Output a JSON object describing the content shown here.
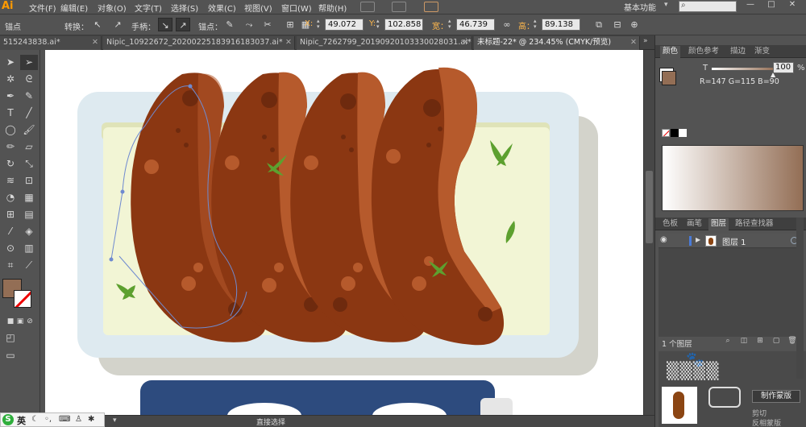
{
  "menubar": {
    "logo": "Ai",
    "items": [
      "文件(F)",
      "编辑(E)",
      "对象(O)",
      "文字(T)",
      "选择(S)",
      "效果(C)",
      "视图(V)",
      "窗口(W)",
      "帮助(H)"
    ],
    "workspace": "基本功能"
  },
  "controlbar": {
    "tool_label": "锚点",
    "convert_label": "转换：",
    "handle_label": "手柄：",
    "anchor_label": "锚点：",
    "x_label": "X:",
    "x_value": "49.072",
    "y_label": "Y:",
    "y_value": "102.858",
    "w_label": "宽：",
    "w_value": "46.739",
    "h_label": "高：",
    "h_value": "89.138"
  },
  "tabs": [
    {
      "label": "515243838.ai*",
      "active": false
    },
    {
      "label": "Nipic_10922672_20200225183916183037.ai*",
      "active": false
    },
    {
      "label": "Nipic_7262799_20190920103330028031.ai*",
      "active": false
    },
    {
      "label": "未标题-22* @ 234.45% (CMYK/预览)",
      "active": true
    }
  ],
  "color_panel": {
    "tabs": [
      "颜色",
      "颜色参考",
      "描边",
      "渐变"
    ],
    "tint_label": "T",
    "tint_value": "100",
    "tint_unit": "%",
    "readout": "R=147 G=115 B=90",
    "fill_color": "#936e55"
  },
  "layers_panel": {
    "tabs": [
      "色板",
      "画笔",
      "图层",
      "路径查找器"
    ],
    "layers": [
      {
        "name": "图层 1"
      }
    ],
    "count": "1 个图层"
  },
  "bottom_panel": {
    "mask_button": "制作蒙版",
    "clip_label": "剪切",
    "invert_label": "反相蒙版"
  },
  "statusbar": {
    "tool_status": "直接选择",
    "ime_lang": "英"
  },
  "artwork": {
    "sausage_dark": "#8b3712",
    "sausage_light": "#b65a2c",
    "tray_color": "#deeaf0",
    "tray_shadow": "#d3d3cb",
    "plate_color": "#f2f5d5",
    "leaf_color": "#5da02f",
    "dish_color": "#2d4b7e"
  }
}
